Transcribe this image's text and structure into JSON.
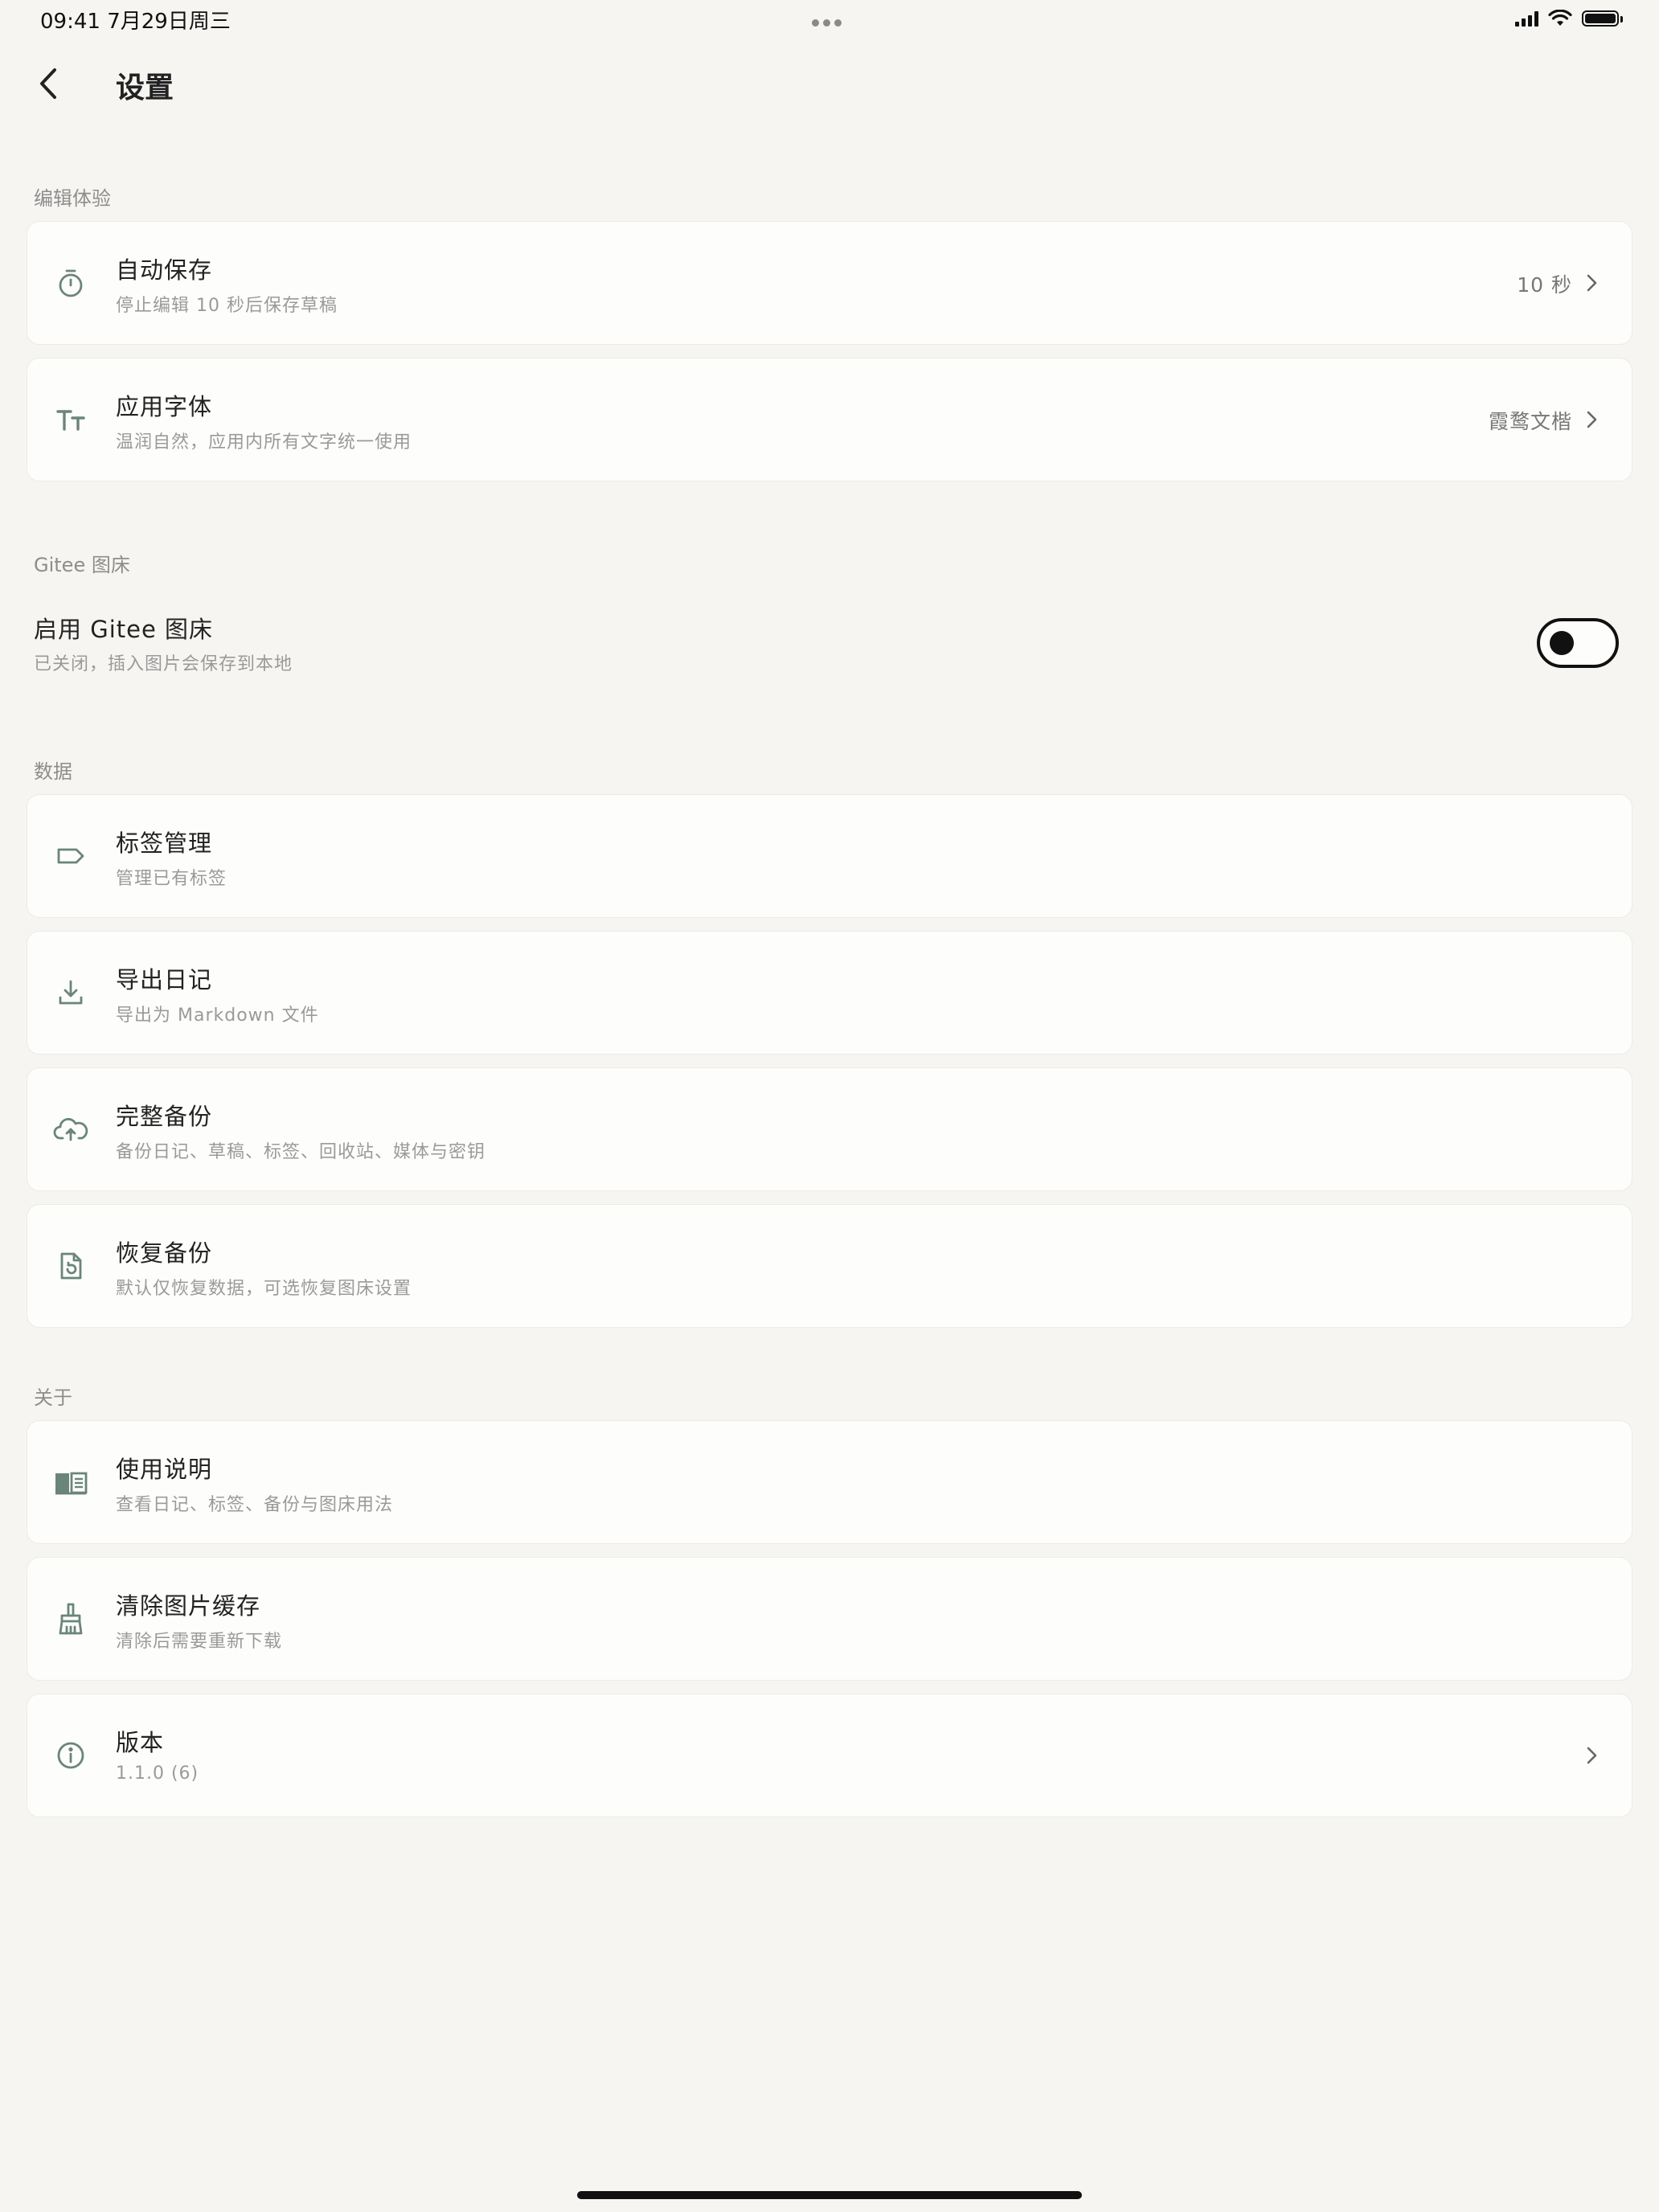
{
  "status_bar": {
    "time_date": "09:41   7月29日周三"
  },
  "header": {
    "title": "设置"
  },
  "sections": {
    "editing": "编辑体验",
    "gitee": "Gitee 图床",
    "data": "数据",
    "about": "关于"
  },
  "autosave": {
    "title": "自动保存",
    "subtitle": "停止编辑 10 秒后保存草稿",
    "value": "10 秒",
    "icon": "timer-icon"
  },
  "font": {
    "title": "应用字体",
    "subtitle": "温润自然，应用内所有文字统一使用",
    "value": "霞鹜文楷",
    "icon": "text-size-icon"
  },
  "gitee_toggle": {
    "title": "启用 Gitee 图床",
    "subtitle": "已关闭，插入图片会保存到本地",
    "enabled": false
  },
  "tags": {
    "title": "标签管理",
    "subtitle": "管理已有标签",
    "icon": "tag-icon"
  },
  "export": {
    "title": "导出日记",
    "subtitle": "导出为 Markdown 文件",
    "icon": "download-icon"
  },
  "backup": {
    "title": "完整备份",
    "subtitle": "备份日记、草稿、标签、回收站、媒体与密钥",
    "icon": "cloud-upload-icon"
  },
  "restore": {
    "title": "恢复备份",
    "subtitle": "默认仅恢复数据，可选恢复图床设置",
    "icon": "file-restore-icon"
  },
  "guide": {
    "title": "使用说明",
    "subtitle": "查看日记、标签、备份与图床用法",
    "icon": "book-icon"
  },
  "clear_cache": {
    "title": "清除图片缓存",
    "subtitle": "清除后需要重新下载",
    "icon": "broom-icon"
  },
  "version": {
    "title": "版本",
    "subtitle": "1.1.0 (6)",
    "icon": "info-icon"
  },
  "colors": {
    "background": "#f6f5f2",
    "card": "#fdfdfb",
    "icon_accent": "#6a857a"
  }
}
